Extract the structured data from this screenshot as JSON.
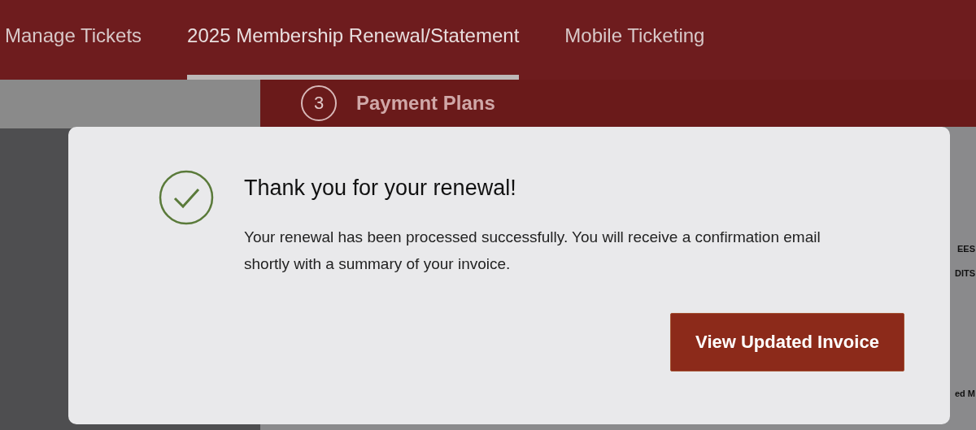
{
  "tabs": [
    {
      "label": "Manage Tickets",
      "selected": false
    },
    {
      "label": "2025 Membership Renewal/Statement",
      "selected": true
    },
    {
      "label": "Mobile Ticketing",
      "selected": false
    }
  ],
  "step": {
    "number": "3",
    "title": "Payment Plans"
  },
  "edge_texts": [
    "EES",
    "DITS",
    "ed M"
  ],
  "modal": {
    "title": "Thank you for your renewal!",
    "message": "Your renewal has been processed successfully. You will receive a confirmation email shortly with a summary of your invoice.",
    "button": "View Updated Invoice"
  }
}
